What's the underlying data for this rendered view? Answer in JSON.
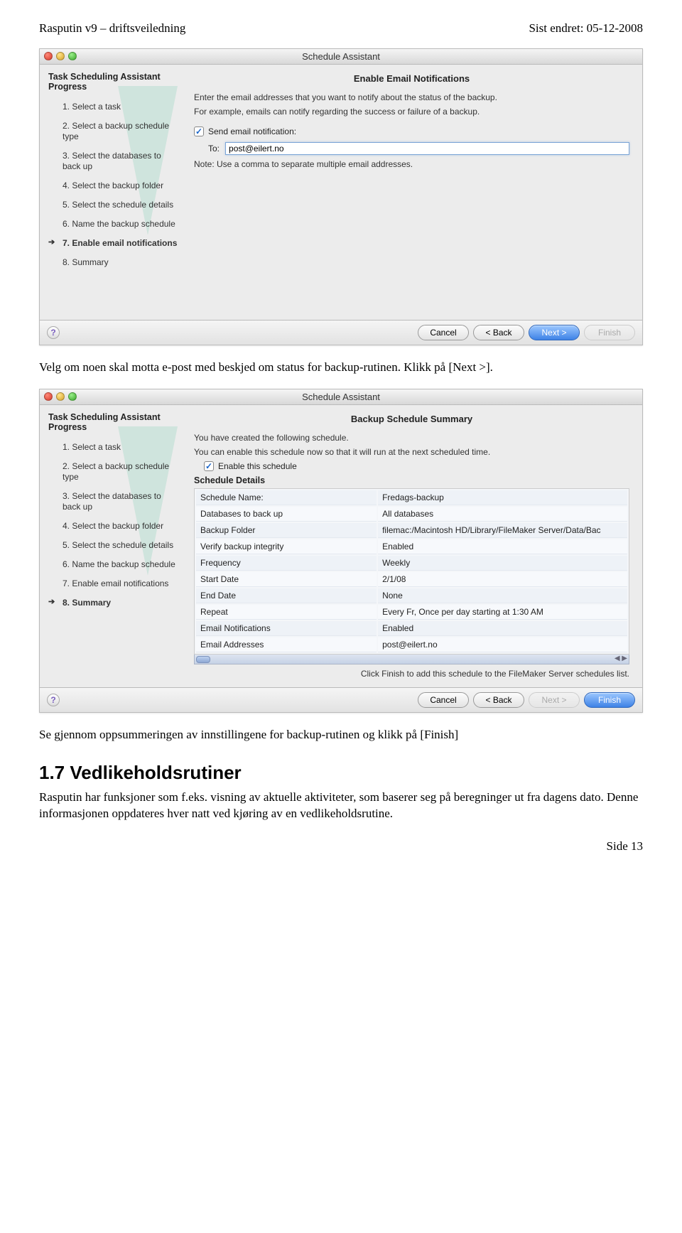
{
  "page_header": {
    "left": "Rasputin v9 – driftsveiledning",
    "right": "Sist endret: 05-12-2008"
  },
  "win1": {
    "title": "Schedule Assistant",
    "sidebar_heading": "Task Scheduling Assistant Progress",
    "steps": [
      "1. Select a task",
      "2. Select a backup schedule type",
      "3. Select the databases to back up",
      "4. Select the backup folder",
      "5. Select the schedule details",
      "6. Name the backup schedule",
      "7. Enable email notifications",
      "8. Summary"
    ],
    "active_step_index": 6,
    "pane_title": "Enable Email Notifications",
    "intro1": "Enter the email addresses that you want to notify about the status of the backup.",
    "intro2": "For example, emails can notify regarding the success or failure of a backup.",
    "cb_label": "Send email notification:",
    "to_label": "To:",
    "to_value": "post@eilert.no",
    "note": "Note: Use a comma to separate multiple email addresses.",
    "buttons": {
      "cancel": "Cancel",
      "back": "< Back",
      "next": "Next >",
      "finish": "Finish"
    }
  },
  "mid_text": "Velg om noen skal motta e-post med beskjed om status for backup-rutinen. Klikk på [Next >].",
  "win2": {
    "title": "Schedule Assistant",
    "sidebar_heading": "Task Scheduling Assistant Progress",
    "steps": [
      "1. Select a task",
      "2. Select a backup schedule type",
      "3. Select the databases to back up",
      "4. Select the backup folder",
      "5. Select the schedule details",
      "6. Name the backup schedule",
      "7. Enable email notifications",
      "8. Summary"
    ],
    "active_step_index": 7,
    "pane_title": "Backup Schedule Summary",
    "intro1": "You have created the following schedule.",
    "intro2": "You can enable this schedule now so that it will run at the next scheduled time.",
    "cb_label": "Enable this schedule",
    "details_heading": "Schedule Details",
    "rows": [
      {
        "k": "Schedule Name:",
        "v": "Fredags-backup"
      },
      {
        "k": "Databases to back up",
        "v": "All databases"
      },
      {
        "k": "Backup Folder",
        "v": "filemac:/Macintosh HD/Library/FileMaker Server/Data/Bac"
      },
      {
        "k": "Verify backup integrity",
        "v": "Enabled"
      },
      {
        "k": "Frequency",
        "v": "Weekly"
      },
      {
        "k": "Start Date",
        "v": "2/1/08"
      },
      {
        "k": "End Date",
        "v": "None"
      },
      {
        "k": "Repeat",
        "v": "Every Fr, Once per day starting at 1:30 AM"
      },
      {
        "k": "Email Notifications",
        "v": "Enabled"
      },
      {
        "k": "Email Addresses",
        "v": "post@eilert.no"
      }
    ],
    "click_finish": "Click Finish to add this schedule to the FileMaker Server schedules list.",
    "buttons": {
      "cancel": "Cancel",
      "back": "< Back",
      "next": "Next >",
      "finish": "Finish"
    }
  },
  "after_win2_text": "Se gjennom oppsummeringen av innstillingene for backup-rutinen og klikk på [Finish]",
  "section_heading": "1.7   Vedlikeholdsrutiner",
  "section_body": "Rasputin har funksjoner som f.eks. visning av aktuelle aktiviteter, som baserer seg på beregninger ut fra dagens dato. Denne informasjonen oppdateres hver natt ved kjøring av en vedlikeholdsrutine.",
  "page_num": "Side 13",
  "hscroll_arrows": "◀ ▶"
}
